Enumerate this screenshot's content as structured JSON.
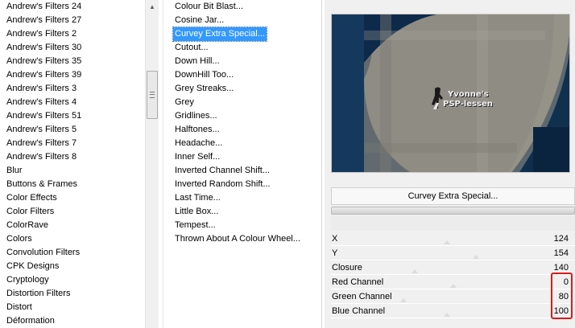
{
  "categories": {
    "items": [
      "Andrew's Filters 24",
      "Andrew's Filters 27",
      "Andrew's Filters 2",
      "Andrew's Filters 30",
      "Andrew's Filters 35",
      "Andrew's Filters 39",
      "Andrew's Filters 3",
      "Andrew's Filters 4",
      "Andrew's Filters 51",
      "Andrew's Filters 5",
      "Andrew's Filters 7",
      "Andrew's Filters 8",
      "Blur",
      "Buttons & Frames",
      "Color Effects",
      "Color Filters",
      "ColorRave",
      "Colors",
      "Convolution Filters",
      "CPK Designs",
      "Cryptology",
      "Distortion Filters",
      "Distort",
      "Déformation"
    ]
  },
  "filters": {
    "selected_index": 2,
    "items": [
      "Colour Bit Blast...",
      "Cosine Jar...",
      "Curvey Extra Special...",
      "Cutout...",
      "Down Hill...",
      "DownHill Too...",
      "Grey Streaks...",
      "Grey",
      "Gridlines...",
      "Halftones...",
      "Headache...",
      "Inner Self...",
      "Inverted Channel Shift...",
      "Inverted Random Shift...",
      "Last Time...",
      "Little Box...",
      "Tempest...",
      "Thrown About A Colour Wheel..."
    ]
  },
  "preview": {
    "watermark_line1": "Yvonne's",
    "watermark_line2": "PSP-lessen"
  },
  "filter_name_button": "Curvey Extra Special...",
  "params": [
    {
      "label": "X",
      "value": "124"
    },
    {
      "label": "Y",
      "value": "154"
    },
    {
      "label": "Closure",
      "value": "140"
    },
    {
      "label": "Red Channel",
      "value": "0"
    },
    {
      "label": "Green Channel",
      "value": "80"
    },
    {
      "label": "Blue Channel",
      "value": "100"
    }
  ],
  "colors": {
    "selection": "#3399ff",
    "highlight_box": "#e01818",
    "preview_dark": "#0d2a4a",
    "preview_grey": "#8f8c83"
  }
}
